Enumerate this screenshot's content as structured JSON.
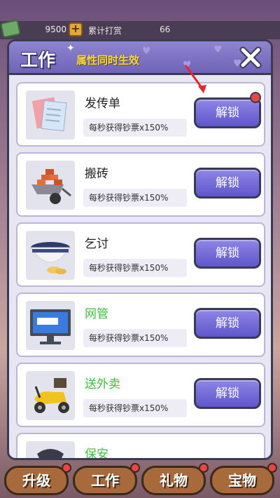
{
  "topbar": {
    "money_value": "9500",
    "tip_label": "累计打赏",
    "tip_value": "66"
  },
  "modal": {
    "title": "工作",
    "subtitle": "属性同时生效"
  },
  "jobs": [
    {
      "name": "发传单",
      "effect": "每秒获得钞票x150%",
      "button": "解锁",
      "icon": "flyer-icon"
    },
    {
      "name": "搬砖",
      "effect": "每秒获得钞票x150%",
      "button": "解锁",
      "icon": "brick-wheelbarrow-icon"
    },
    {
      "name": "乞讨",
      "effect": "每秒获得钞票x150%",
      "button": "解锁",
      "icon": "begging-bowl-icon"
    },
    {
      "name": "网管",
      "effect": "每秒获得钞票x150%",
      "button": "解锁",
      "icon": "computer-monitor-icon"
    },
    {
      "name": "送外卖",
      "effect": "每秒获得钞票x150%",
      "button": "解锁",
      "icon": "scooter-icon"
    },
    {
      "name": "保安",
      "effect": "",
      "button": "",
      "icon": "security-cap-icon"
    }
  ],
  "bottom_tabs": [
    {
      "label": "升级"
    },
    {
      "label": "工作"
    },
    {
      "label": "礼物"
    },
    {
      "label": "宝物"
    }
  ],
  "colors": {
    "accent": "#6e63b8",
    "button": "#5f56cc",
    "subtitle": "#f7d54a",
    "job_name_green": "#3fbf3f",
    "badge_red": "#e84545"
  }
}
